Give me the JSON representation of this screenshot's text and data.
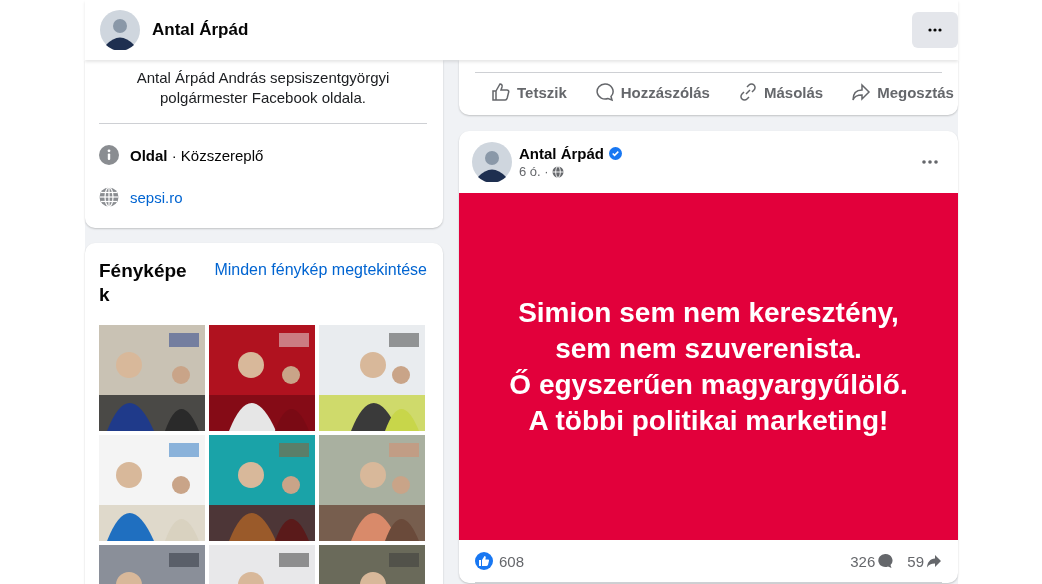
{
  "header": {
    "name": "Antal Árpád"
  },
  "intro": {
    "bio": "Antal Árpád András sepsiszentgyörgyi polgármester Facebook oldala.",
    "category_label": "Oldal",
    "separator": "·",
    "category": "Közszereplő",
    "website": "sepsi.ro"
  },
  "photos": {
    "title": "Fényképek",
    "link": "Minden fénykép megtekintése"
  },
  "previous_post": {
    "actions": [
      {
        "kind": "like",
        "label": "Tetszik"
      },
      {
        "kind": "comment",
        "label": "Hozzászólás"
      },
      {
        "kind": "copy",
        "label": "Másolás"
      },
      {
        "kind": "share",
        "label": "Megosztás"
      }
    ]
  },
  "post": {
    "author": "Antal Árpád",
    "verified": true,
    "time": "6 ó.",
    "separator": "·",
    "text": "Simion sem nem keresztény,\nsem nem szuverenista.\nŐ egyszerűen magyargyűlölő.\nA többi politikai marketing!",
    "likes": "608",
    "comments": "326",
    "shares": "59"
  }
}
